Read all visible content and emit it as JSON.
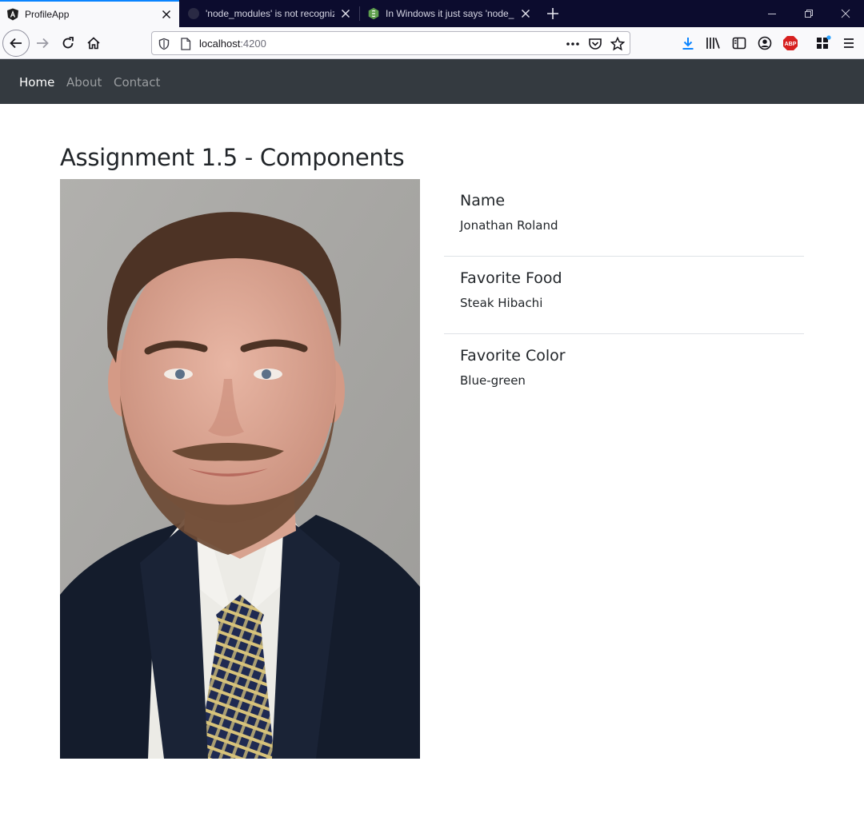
{
  "browser": {
    "tabs": [
      {
        "title": "ProfileApp",
        "active": true
      },
      {
        "title": "'node_modules' is not recognized",
        "active": false
      },
      {
        "title": "In Windows it just says 'node_modules'",
        "active": false
      }
    ],
    "url_host": "localhost",
    "url_port": ":4200",
    "icons": {
      "back": "back-arrow-icon",
      "forward": "forward-arrow-icon",
      "reload": "reload-icon",
      "home": "home-icon",
      "shield": "tracking-shield-icon",
      "page": "page-icon",
      "more": "more-dots-icon",
      "pocket": "pocket-icon",
      "bookmark": "bookmark-star-icon",
      "download": "download-icon",
      "library": "library-icon",
      "sidebar": "sidebar-icon",
      "account": "account-icon",
      "adblock": "adblock-plus-icon",
      "extensions": "extensions-icon",
      "menu": "hamburger-menu-icon"
    },
    "adblock_text": "ABP",
    "accent": "#0a84ff"
  },
  "nav": {
    "items": [
      {
        "label": "Home",
        "active": true
      },
      {
        "label": "About",
        "active": false
      },
      {
        "label": "Contact",
        "active": false
      }
    ],
    "background": "#343a40"
  },
  "main": {
    "title": "Assignment 1.5 - Components",
    "profile": [
      {
        "label": "Name",
        "value": "Jonathan Roland"
      },
      {
        "label": "Favorite Food",
        "value": "Steak Hibachi"
      },
      {
        "label": "Favorite Color",
        "value": "Blue-green"
      }
    ]
  }
}
